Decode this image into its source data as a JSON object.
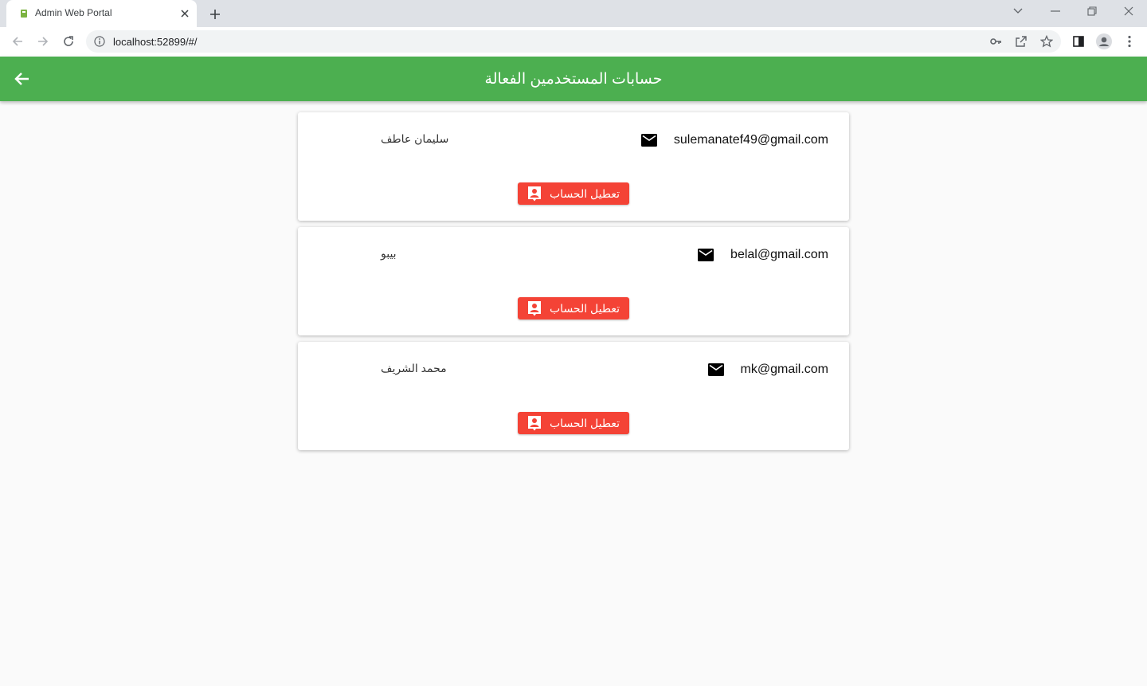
{
  "browser": {
    "tab_title": "Admin Web Portal",
    "url": "localhost:52899/#/"
  },
  "appbar": {
    "title": "حسابات المستخدمين الفعالة",
    "color": "#4caf50"
  },
  "accounts": [
    {
      "email": "sulemanatef49@gmail.com",
      "name": "سليمان عاطف",
      "button_label": "تعطيل الحساب"
    },
    {
      "email": "belal@gmail.com",
      "name": "بيبو",
      "button_label": "تعطيل الحساب"
    },
    {
      "email": "mk@gmail.com",
      "name": "محمد الشريف",
      "button_label": "تعطيل الحساب"
    }
  ],
  "colors": {
    "button": "#f44336",
    "background": "#fafafa"
  },
  "icons": [
    "back-arrow-icon",
    "mail-icon",
    "person-badge-icon"
  ]
}
